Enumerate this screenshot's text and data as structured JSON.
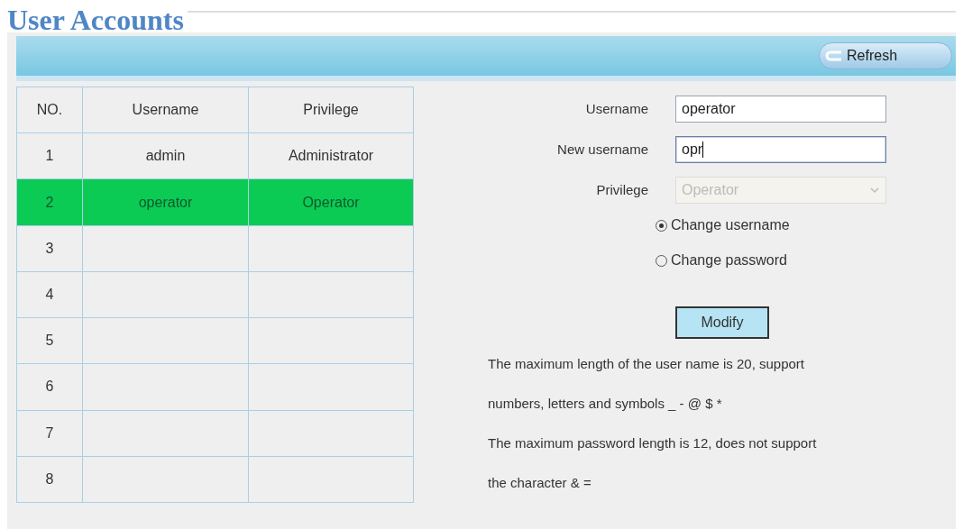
{
  "title": "User Accounts",
  "toolbar": {
    "refresh_button": "Refresh"
  },
  "table": {
    "columns": [
      "NO.",
      "Username",
      "Privilege"
    ],
    "rows": [
      {
        "cells": [
          "1",
          "admin",
          "Administrator"
        ],
        "selected": false
      },
      {
        "cells": [
          "2",
          "operator",
          "Operator"
        ],
        "selected": true
      },
      {
        "cells": [
          "3",
          "",
          ""
        ],
        "selected": false
      },
      {
        "cells": [
          "4",
          "",
          ""
        ],
        "selected": false
      },
      {
        "cells": [
          "5",
          "",
          ""
        ],
        "selected": false
      },
      {
        "cells": [
          "6",
          "",
          ""
        ],
        "selected": false
      },
      {
        "cells": [
          "7",
          "",
          ""
        ],
        "selected": false
      },
      {
        "cells": [
          "8",
          "",
          ""
        ],
        "selected": false
      }
    ]
  },
  "form": {
    "fields": [
      {
        "label": "Username",
        "kind": "text",
        "value": "operator",
        "focused": false,
        "disabled": false
      },
      {
        "label": "New username",
        "kind": "text",
        "value": "opr",
        "focused": true,
        "disabled": false
      },
      {
        "label": "Privilege",
        "kind": "select",
        "value": "Operator",
        "focused": false,
        "disabled": true
      }
    ],
    "radios": [
      {
        "label": "Change username",
        "selected": true
      },
      {
        "label": "Change password",
        "selected": false
      }
    ],
    "modify_button": "Modify",
    "notes": [
      "The maximum length of the user name is 20, support\nnumbers, letters and symbols _ - @ $ *",
      "The maximum password length is 12, does not support\nthe character & ="
    ]
  }
}
